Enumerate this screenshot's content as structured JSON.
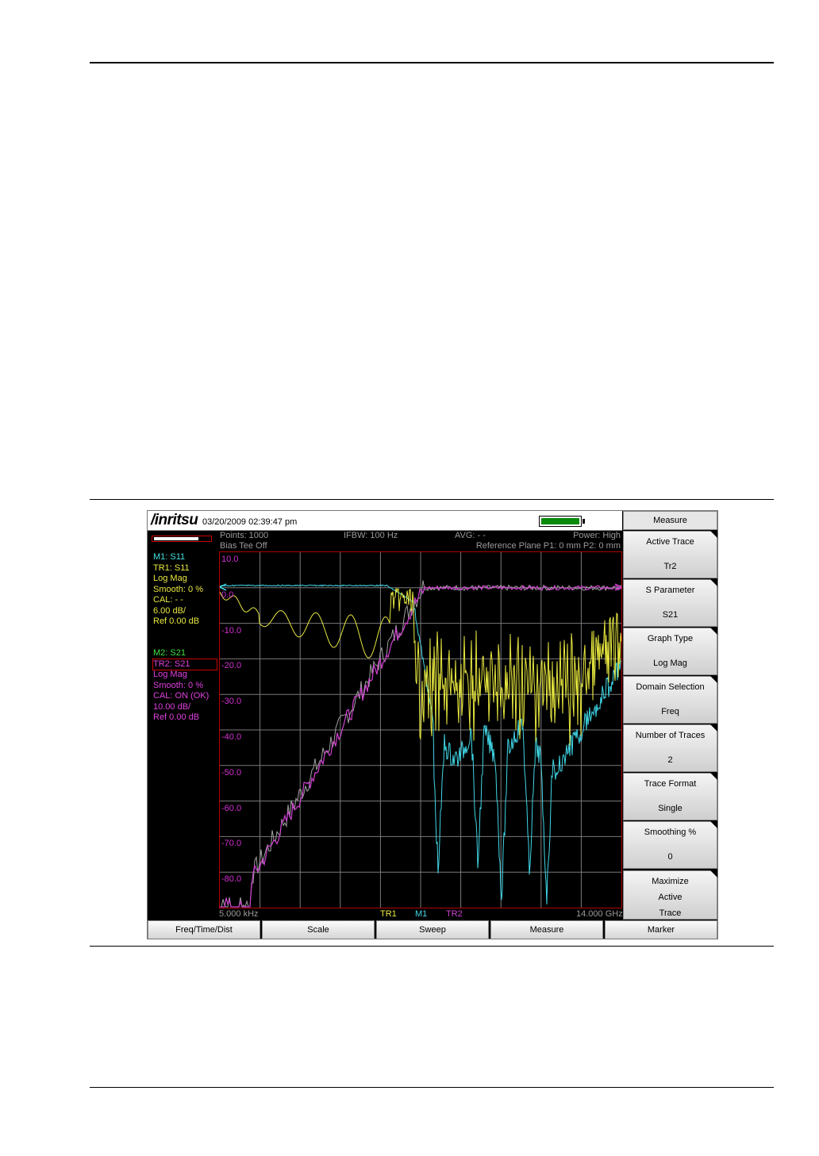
{
  "header": {
    "logo": "/inritsu",
    "datetime": "03/20/2009 02:39:47 pm"
  },
  "status": {
    "points": "Points: 1000",
    "ifbw": "IFBW: 100 Hz",
    "avg": "AVG: - -",
    "power": "Power: High",
    "bias_tee": "Bias Tee Off",
    "ref_plane": "Reference Plane P1: 0 mm P2: 0 mm"
  },
  "trace1": {
    "lines": [
      "M1: S11",
      "TR1: S11",
      "Log Mag",
      "Smooth: 0 %",
      "CAL: - -",
      "6.00 dB/",
      "Ref 0.00 dB"
    ],
    "colors": [
      "#40e0e0",
      "#e8e840",
      "#e8e840",
      "#e8e840",
      "#e8e840",
      "#e8e840",
      "#e8e840"
    ]
  },
  "trace2": {
    "lines": [
      "M2: S21",
      "TR2: S21",
      "Log Mag",
      "Smooth: 0 %",
      "CAL: ON (OK)",
      "10.00 dB/",
      "Ref 0.00 dB"
    ],
    "colors": [
      "#40e040",
      "#e040e0",
      "#e040e0",
      "#e040e0",
      "#e040e0",
      "#e040e0",
      "#e040e0"
    ]
  },
  "plot": {
    "y_labels": [
      "10.0",
      "0.0",
      "-10.0",
      "-20.0",
      "-30.0",
      "-40.0",
      "-50.0",
      "-60.0",
      "-70.0",
      "-80.0"
    ],
    "x_start": "5.000 kHz",
    "x_stop": "14.000 GHz",
    "trace_labels": {
      "tr1": "TR1",
      "m1": "M1",
      "tr2": "TR2"
    },
    "colors": {
      "s11": "#e8e840",
      "s11_mem": "#40d8e8",
      "s21": "#d040d0",
      "s21_mem": "#a0a0a0",
      "grid": "#7a7a7a",
      "border": "#b00000"
    }
  },
  "softkeys": {
    "title": "Measure",
    "items": [
      {
        "l1": "Active Trace",
        "l2": "Tr2"
      },
      {
        "l1": "S Parameter",
        "l2": "S21"
      },
      {
        "l1": "Graph Type",
        "l2": "Log Mag"
      },
      {
        "l1": "Domain Selection",
        "l2": "Freq"
      },
      {
        "l1": "Number of Traces",
        "l2": "2"
      },
      {
        "l1": "Trace Format",
        "l2": "Single"
      },
      {
        "l1": "Smoothing %",
        "l2": "0"
      }
    ],
    "last": [
      "Maximize",
      "Active",
      "Trace"
    ]
  },
  "bottom_keys": [
    "Freq/Time/Dist",
    "Scale",
    "Sweep",
    "Measure",
    "Marker"
  ]
}
